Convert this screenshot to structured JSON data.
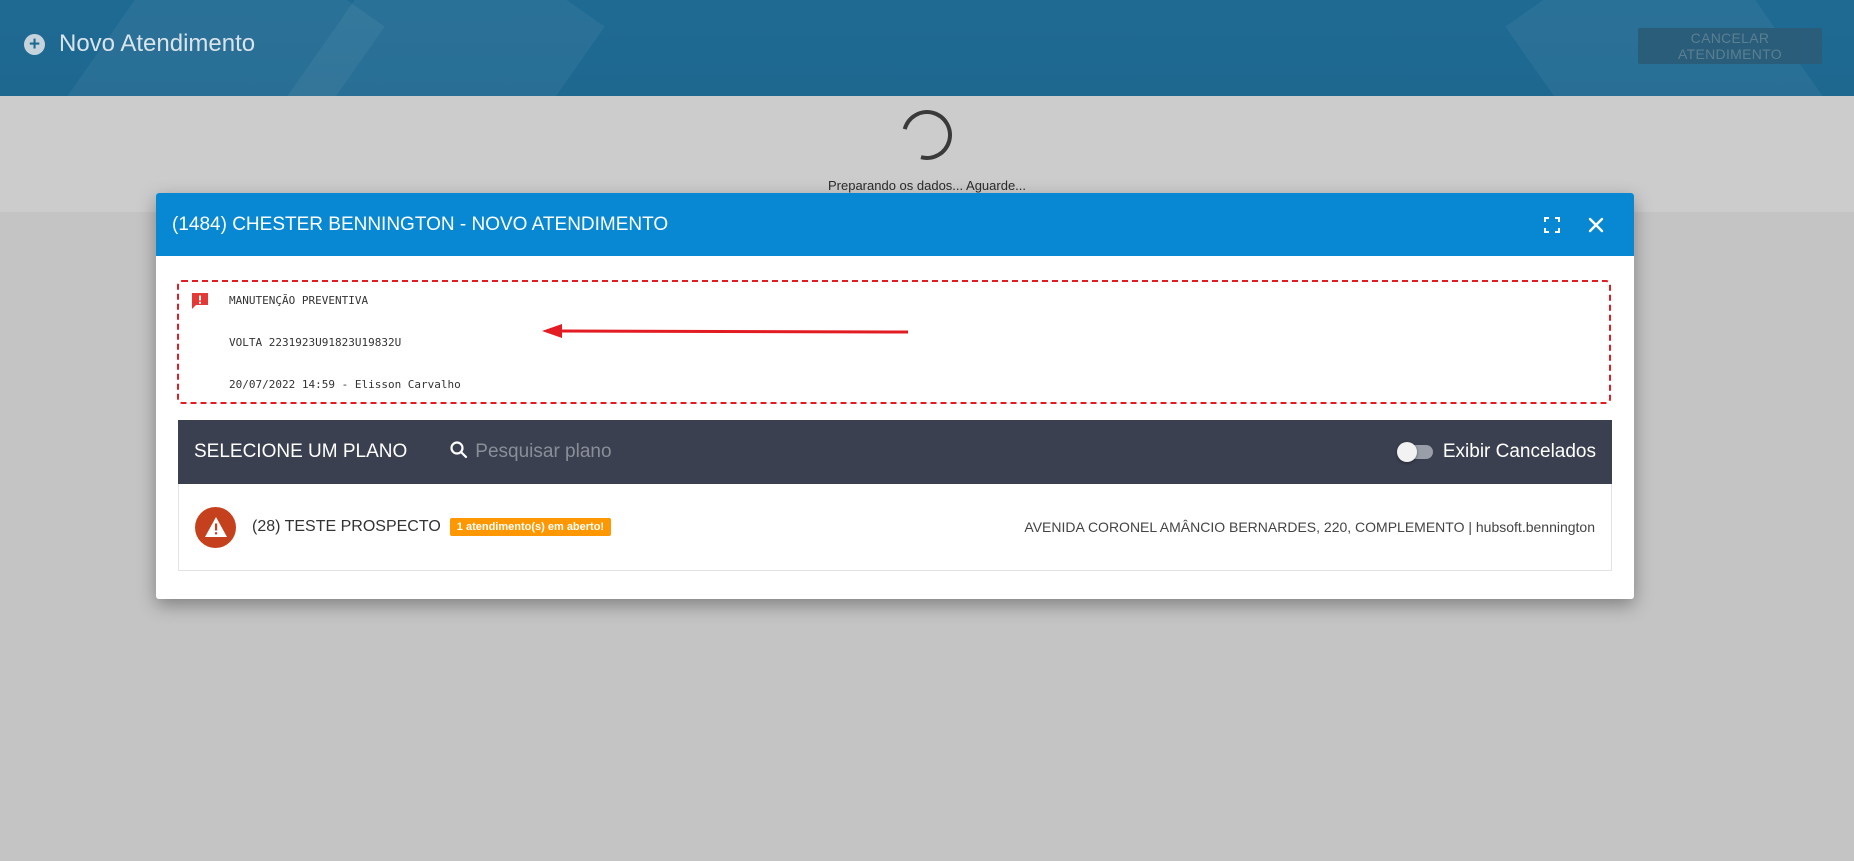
{
  "topbar": {
    "title": "Novo Atendimento",
    "cancel_label": "CANCELAR ATENDIMENTO"
  },
  "loading": {
    "text": "Preparando os dados... Aguarde..."
  },
  "modal": {
    "title": "(1484) CHESTER BENNINGTON - NOVO ATENDIMENTO",
    "note": {
      "line1": "MANUTENÇÃO PREVENTIVA",
      "line2": "VOLTA 2231923U91823U19832U",
      "line3": "20/07/2022 14:59 - Elisson Carvalho"
    },
    "plan_bar": {
      "title": "SELECIONE UM PLANO",
      "search_placeholder": "Pesquisar plano",
      "toggle_label": "Exibir Cancelados"
    },
    "plan": {
      "name": "(28) TESTE PROSPECTO",
      "badge": "1 atendimento(s) em aberto!",
      "address": "AVENIDA CORONEL AMÂNCIO BERNARDES, 220, COMPLEMENTO |  hubsoft.bennington"
    }
  },
  "colors": {
    "topbar": "#1f6a93",
    "modal_header": "#0888d3",
    "plan_bar": "#3b4050",
    "badge": "#ff9800",
    "warning": "#c5411d",
    "note_border": "#e31b23"
  },
  "icons": [
    "plus-circle-icon",
    "fullscreen-icon",
    "close-icon",
    "comment-alert-icon",
    "search-icon",
    "warning-icon"
  ]
}
